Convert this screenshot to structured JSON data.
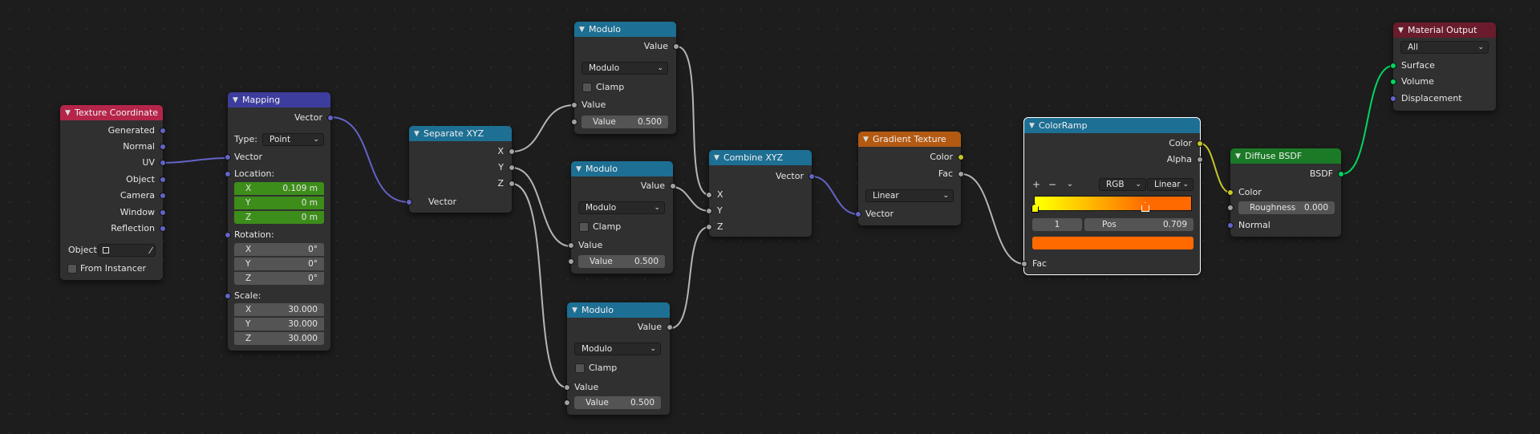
{
  "nodes": {
    "texcoord": {
      "title": "Texture Coordinate",
      "outputs": [
        "Generated",
        "Normal",
        "UV",
        "Object",
        "Camera",
        "Window",
        "Reflection"
      ],
      "object_label": "Object:",
      "from_instancer": "From Instancer"
    },
    "mapping": {
      "title": "Mapping",
      "vector_out": "Vector",
      "type_label": "Type:",
      "type_value": "Point",
      "vector_in": "Vector",
      "location_label": "Location:",
      "location": [
        {
          "axis": "X",
          "value": "0.109 m"
        },
        {
          "axis": "Y",
          "value": "0 m"
        },
        {
          "axis": "Z",
          "value": "0 m"
        }
      ],
      "rotation_label": "Rotation:",
      "rotation": [
        {
          "axis": "X",
          "value": "0°"
        },
        {
          "axis": "Y",
          "value": "0°"
        },
        {
          "axis": "Z",
          "value": "0°"
        }
      ],
      "scale_label": "Scale:",
      "scale": [
        {
          "axis": "X",
          "value": "30.000"
        },
        {
          "axis": "Y",
          "value": "30.000"
        },
        {
          "axis": "Z",
          "value": "30.000"
        }
      ]
    },
    "separate": {
      "title": "Separate XYZ",
      "outputs": [
        "X",
        "Y",
        "Z"
      ],
      "input": "Vector"
    },
    "modulo1": {
      "title": "Modulo",
      "out": "Value",
      "op": "Modulo",
      "clamp": "Clamp",
      "in1": "Value",
      "in2_label": "Value",
      "in2_value": "0.500"
    },
    "modulo2": {
      "title": "Modulo",
      "out": "Value",
      "op": "Modulo",
      "clamp": "Clamp",
      "in1": "Value",
      "in2_label": "Value",
      "in2_value": "0.500"
    },
    "modulo3": {
      "title": "Modulo",
      "out": "Value",
      "op": "Modulo",
      "clamp": "Clamp",
      "in1": "Value",
      "in2_label": "Value",
      "in2_value": "0.500"
    },
    "combine": {
      "title": "Combine XYZ",
      "output": "Vector",
      "inputs": [
        "X",
        "Y",
        "Z"
      ]
    },
    "gradient": {
      "title": "Gradient Texture",
      "outputs": [
        "Color",
        "Fac"
      ],
      "type": "Linear",
      "input": "Vector"
    },
    "colorramp": {
      "title": "ColorRamp",
      "outputs": [
        "Color",
        "Alpha"
      ],
      "add": "+",
      "remove": "−",
      "mode": "RGB",
      "interp": "Linear",
      "index": "1",
      "pos_label": "Pos",
      "pos_value": "0.709",
      "input": "Fac"
    },
    "diffuse": {
      "title": "Diffuse BSDF",
      "output": "BSDF",
      "color_in": "Color",
      "roughness_label": "Roughness",
      "roughness_value": "0.000",
      "normal_in": "Normal"
    },
    "output": {
      "title": "Material Output",
      "target": "All",
      "inputs": [
        "Surface",
        "Volume",
        "Displacement"
      ]
    }
  },
  "colors": {
    "header_input": "#b5254a",
    "header_vector": "#3d3d9e",
    "header_converter": "#1d6f93",
    "header_texture": "#b35912",
    "header_shader": "#1a7a25",
    "header_output": "#6a1c2c",
    "socket_vector": "#6363c7",
    "socket_float": "#a1a1a1",
    "socket_color": "#c7c729",
    "socket_shader": "#00d65e",
    "ramp_start": "#ffff00",
    "ramp_end": "#ff6a00",
    "ramp_selected": "#ff6a00"
  },
  "icons": {
    "collapse": "chevron-down-icon",
    "eyedropper": "eyedropper-icon",
    "object": "object-icon"
  }
}
